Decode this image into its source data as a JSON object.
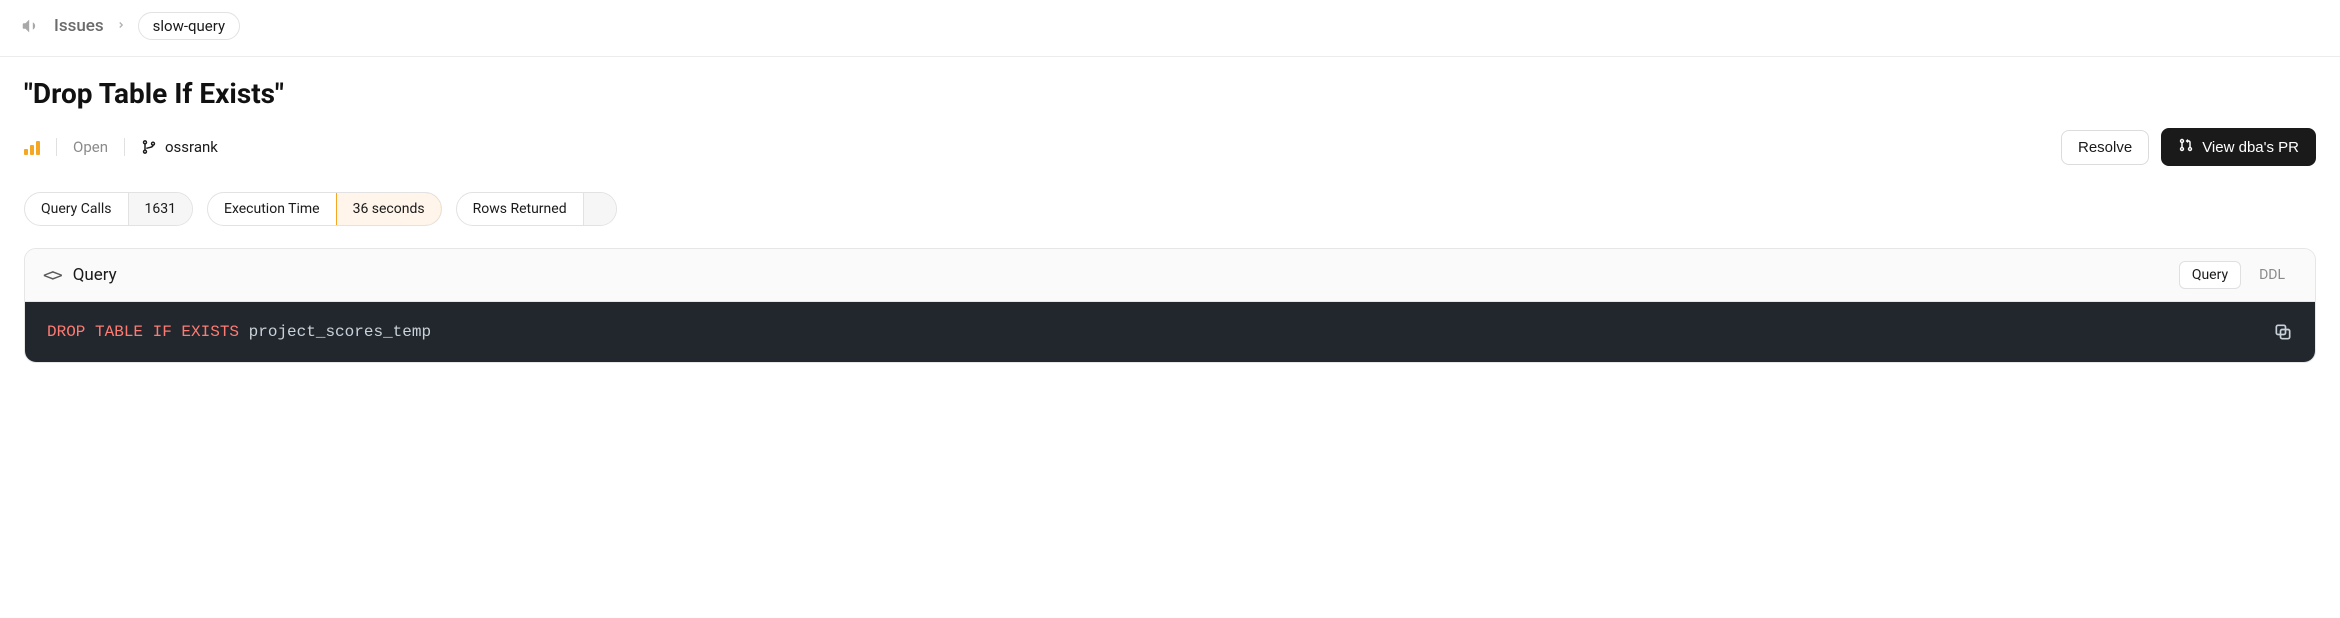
{
  "breadcrumb": {
    "root": "Issues",
    "tag": "slow-query"
  },
  "title": "\"Drop Table If Exists\"",
  "meta": {
    "status": "Open",
    "repo": "ossrank"
  },
  "actions": {
    "resolve": "Resolve",
    "view_pr": "View dba's PR"
  },
  "stats": {
    "query_calls": {
      "label": "Query Calls",
      "value": "1631"
    },
    "execution_time": {
      "label": "Execution Time",
      "value": "36 seconds"
    },
    "rows_returned": {
      "label": "Rows Returned",
      "value": ""
    }
  },
  "query_panel": {
    "title": "Query",
    "tabs": {
      "query": "Query",
      "ddl": "DDL"
    },
    "sql": {
      "keywords": "DROP TABLE IF EXISTS",
      "identifier": "project_scores_temp"
    }
  }
}
